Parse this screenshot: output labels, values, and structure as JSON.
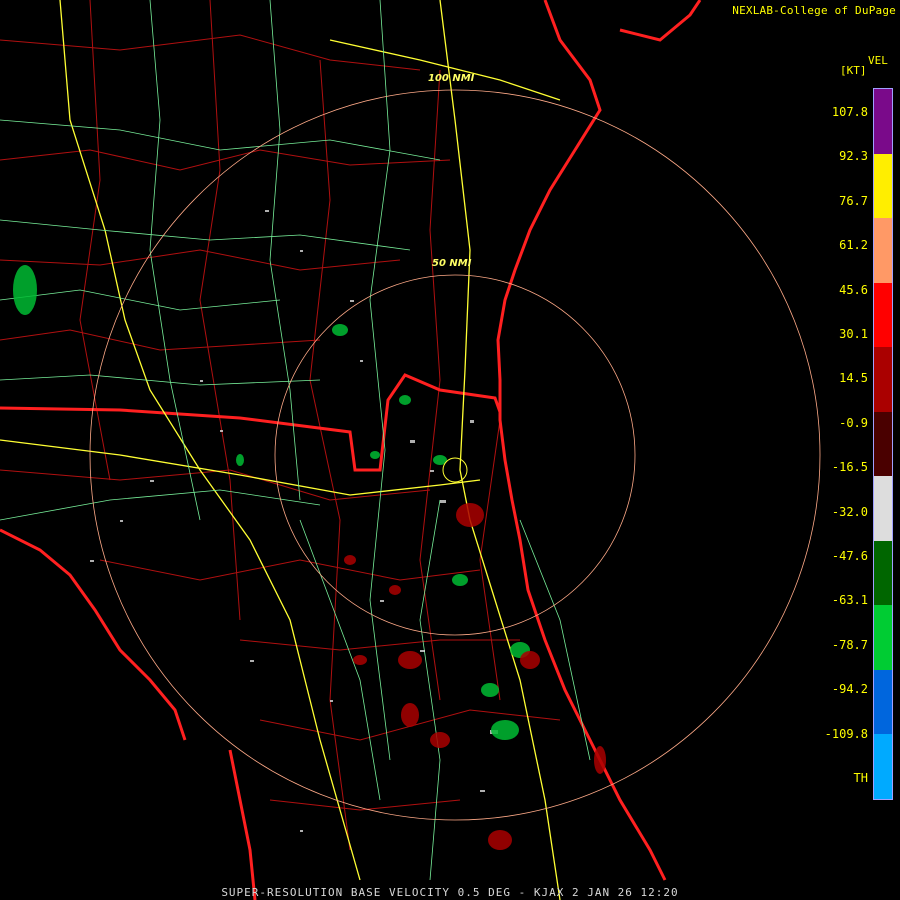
{
  "header": {
    "credit": "NEXLAB-College of DuPage"
  },
  "footer": {
    "caption": "SUPER-RESOLUTION BASE VELOCITY 0.5 DEG - KJAX 2 JAN 26 12:20"
  },
  "legend": {
    "product": "VEL",
    "units": "[KT]",
    "ticks": [
      "107.8",
      "92.3",
      "76.7",
      "61.2",
      "45.6",
      "30.1",
      "14.5",
      "-0.9",
      "-16.5",
      "-32.0",
      "-47.6",
      "-63.1",
      "-78.7",
      "-94.2",
      "-109.8",
      "TH"
    ],
    "colors": [
      "#7a0a8a",
      "#ffee00",
      "#ff9966",
      "#ff0000",
      "#aa0000",
      "#4a0000",
      "#dddddd",
      "#006600",
      "#00cc33",
      "#0066dd",
      "#00aaff"
    ]
  },
  "map": {
    "ring_labels": {
      "inner": "50 NMI",
      "outer": "100 NMI"
    },
    "colors": {
      "state_border": "#ff2020",
      "county": "#cc1010",
      "highway": "#ffff33",
      "road": "#88ffaa",
      "ring": "#ffaa88"
    }
  }
}
